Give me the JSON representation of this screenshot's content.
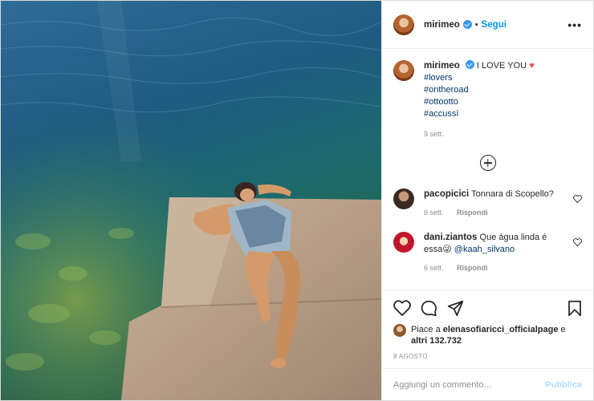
{
  "post": {
    "username": "mirimeo",
    "follow_label": "Segui",
    "more_icon": "more-dots-icon",
    "caption_text": "I LOVE YOU",
    "hashtags": [
      "#lovers",
      "#ontheroad",
      "#ottootto",
      "#accussì"
    ],
    "caption_time": "9 sett.",
    "comments": [
      {
        "user": "pacopicici",
        "text": "Tonnara di Scopello?",
        "time": "6 sett.",
        "reply": "Rispondi"
      },
      {
        "user": "dani.ziantos",
        "text_a": "Que água linda é essa",
        "emoji": "😜",
        "mention": "@kaah_silvano",
        "time": "6 sett.",
        "reply": "Rispondi"
      }
    ],
    "likes_prefix": "Piace a",
    "likes_user": "elenasofiaricci_officialpage",
    "likes_suffix": "e",
    "likes_others": "altri 132.732",
    "date": "8 AGOSTO",
    "comment_placeholder": "Aggiungi un commento...",
    "publish_label": "Pubblica"
  },
  "colors": {
    "accent": "#0095f6",
    "verified": "#3897f0",
    "heart": "#ed4956",
    "publish_disabled": "#b2dffc"
  }
}
